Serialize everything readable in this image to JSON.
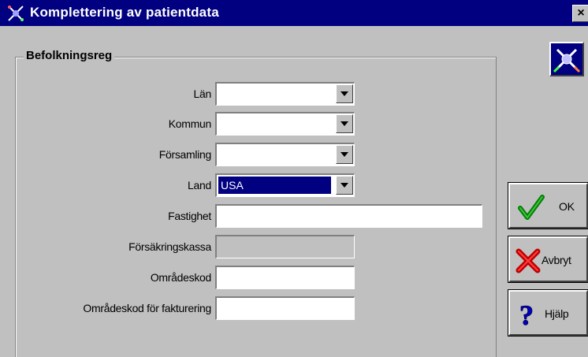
{
  "window": {
    "title": "Komplettering av patientdata",
    "close_label": "×"
  },
  "group": {
    "label": "Befolkningsreg"
  },
  "fields": {
    "lan": {
      "label": "Län",
      "value": ""
    },
    "kommun": {
      "label": "Kommun",
      "value": ""
    },
    "forsamling": {
      "label": "Församling",
      "value": ""
    },
    "land": {
      "label": "Land",
      "value": "USA"
    },
    "fastighet": {
      "label": "Fastighet",
      "value": ""
    },
    "forsakringskassa": {
      "label": "Försäkringskassa",
      "value": ""
    },
    "omradeskod": {
      "label": "Områdeskod",
      "value": ""
    },
    "omradeskod_fakturering": {
      "label": "Områdeskod för fakturering",
      "value": ""
    }
  },
  "buttons": {
    "ok": "OK",
    "cancel": "Avbryt",
    "help": "Hjälp"
  },
  "icons": {
    "title": "app-icon",
    "logo": "app-logo-icon",
    "ok": "checkmark-icon",
    "cancel": "x-icon",
    "help": "question-icon"
  },
  "colors": {
    "titlebar": "#000080",
    "face": "#c0c0c0",
    "selection": "#000080"
  }
}
